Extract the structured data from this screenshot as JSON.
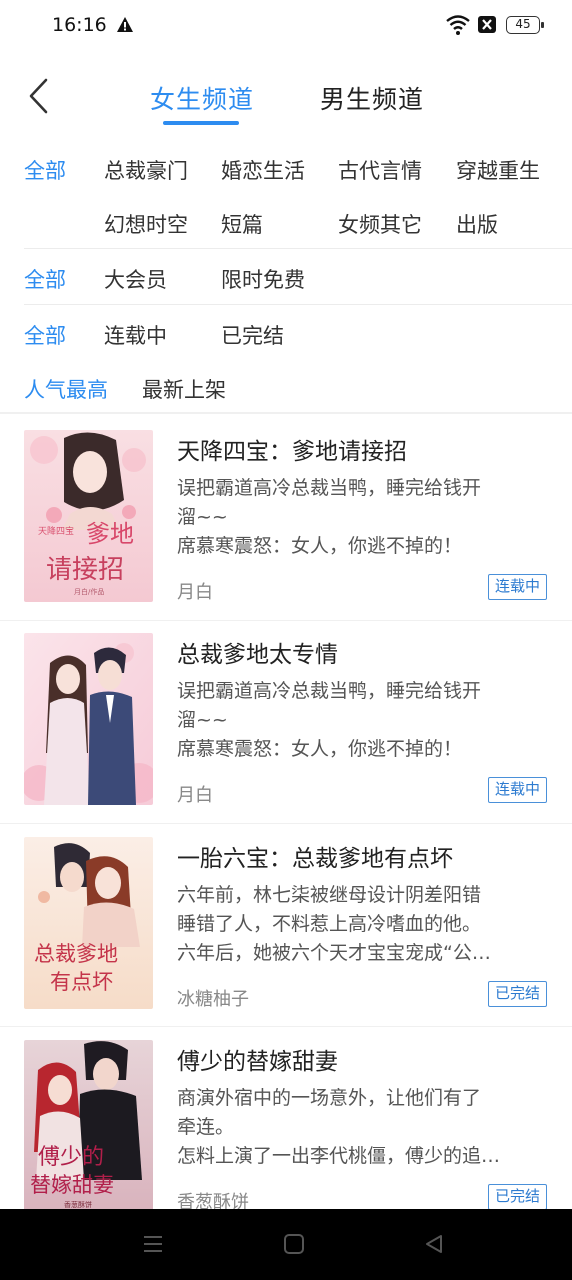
{
  "status_bar": {
    "time": "16:16",
    "battery": "45"
  },
  "header": {
    "tabs": [
      {
        "label": "女生频道",
        "active": true
      },
      {
        "label": "男生频道",
        "active": false
      }
    ]
  },
  "filters": {
    "genre": {
      "selected": "全部",
      "options": [
        "总裁豪门",
        "婚恋生活",
        "古代言情",
        "穿越重生",
        "幻想时空",
        "短篇",
        "女频其它",
        "出版"
      ]
    },
    "membership": {
      "selected": "全部",
      "options": [
        "大会员",
        "限时免费"
      ]
    },
    "progress": {
      "selected": "全部",
      "options": [
        "连载中",
        "已完结"
      ]
    },
    "sort": {
      "selected": "人气最高",
      "options": [
        "最新上架"
      ]
    }
  },
  "books": [
    {
      "title": "天降四宝：爹地请接招",
      "desc": [
        "误把霸道高冷总裁当鸭，睡完给钱开",
        "溜~~",
        "席慕寒震怒：女人，你逃不掉的！"
      ],
      "author": "月白",
      "status": "连载中",
      "cover_text": [
        "天降四宝",
        "爹地",
        "请接招",
        "月白/作品"
      ]
    },
    {
      "title": "总裁爹地太专情",
      "desc": [
        "误把霸道高冷总裁当鸭，睡完给钱开",
        "溜~~",
        "席慕寒震怒：女人，你逃不掉的！"
      ],
      "author": "月白",
      "status": "连载中",
      "cover_text": []
    },
    {
      "title": "一胎六宝：总裁爹地有点坏",
      "desc": [
        "六年前，林七柒被继母设计阴差阳错",
        "睡错了人，不料惹上高冷嗜血的他。",
        "六年后，她被六个天才宝宝宠成“公…"
      ],
      "author": "冰糖柚子",
      "status": "已完结",
      "cover_text": [
        "总裁爹地",
        "有点坏"
      ]
    },
    {
      "title": "傅少的替嫁甜妻",
      "desc": [
        "商演外宿中的一场意外，让他们有了",
        "牵连。",
        "怎料上演了一出李代桃僵，傅少的追…"
      ],
      "author": "香葱酥饼",
      "status": "已完结",
      "cover_text": [
        "傅少的",
        "替嫁甜妻",
        "香葱酥饼"
      ]
    }
  ]
}
